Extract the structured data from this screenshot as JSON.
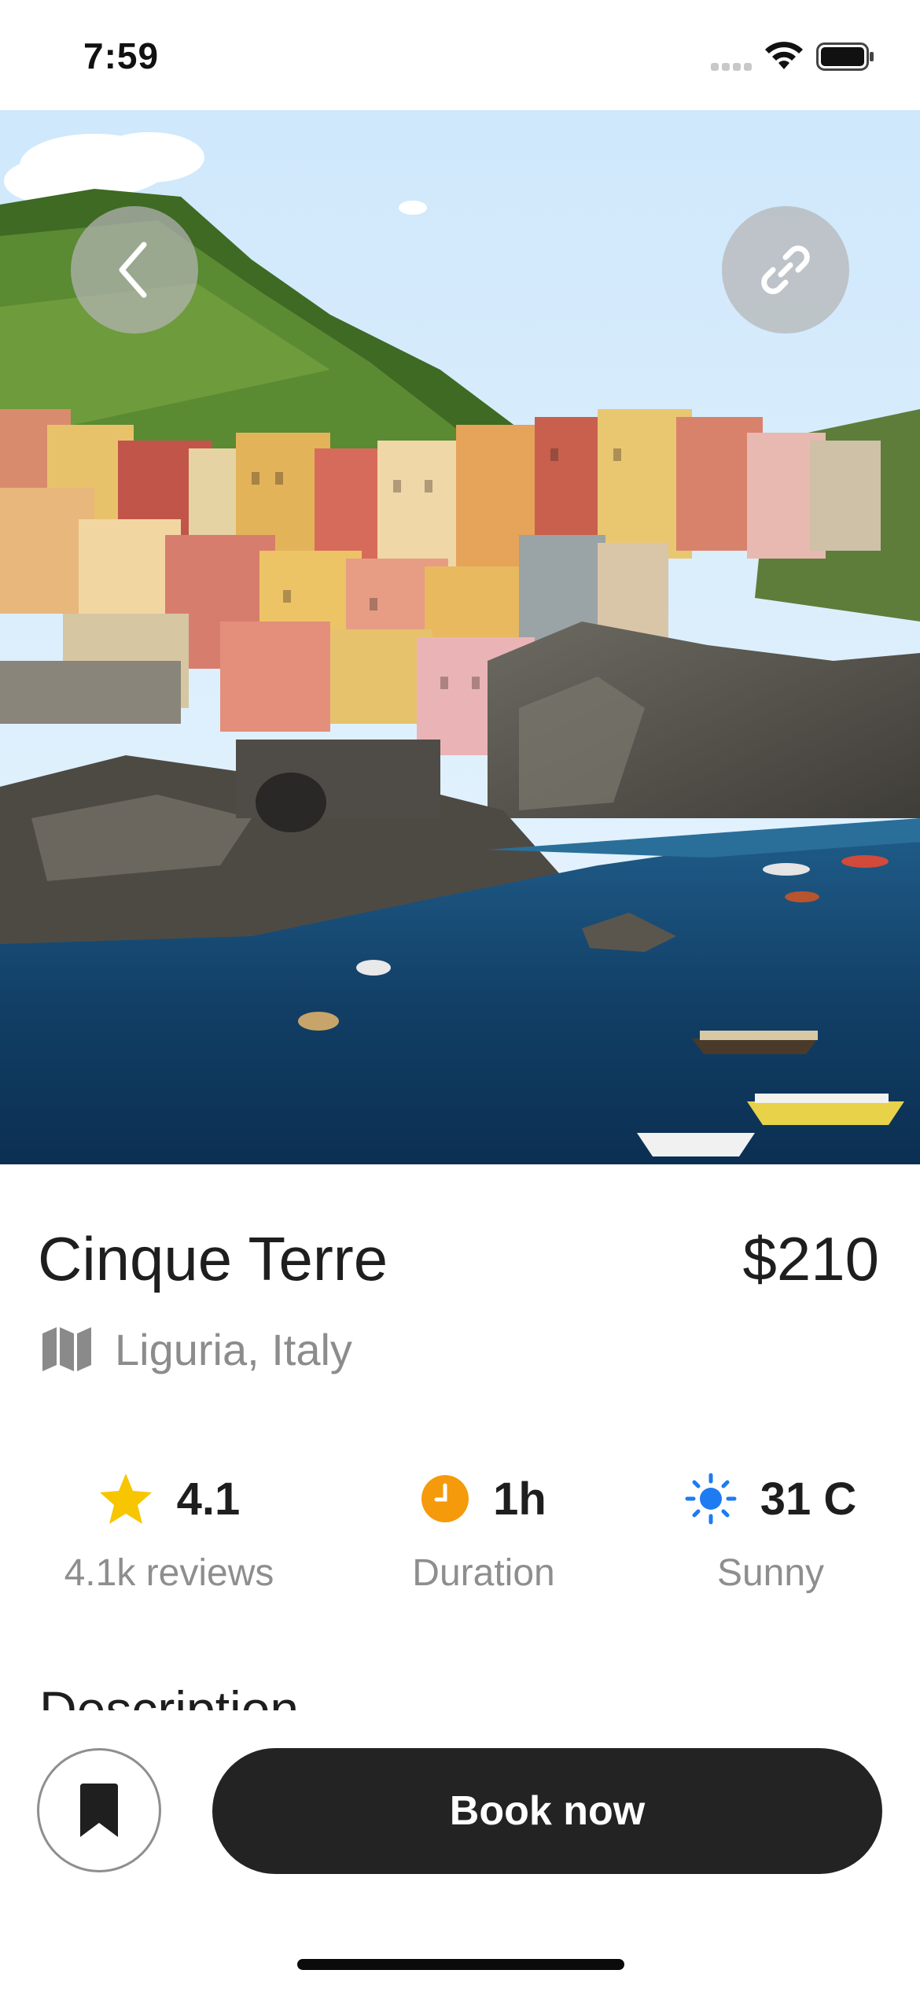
{
  "status_bar": {
    "time": "7:59"
  },
  "hero": {
    "back_icon": "chevron-left-icon",
    "share_icon": "link-icon"
  },
  "place": {
    "title": "Cinque Terre",
    "price": "$210",
    "location_icon": "map-icon",
    "location": "Liguria, Italy"
  },
  "stats": [
    {
      "icon": "star-icon",
      "value": "4.1",
      "label": "4.1k reviews",
      "color": "#F7C600"
    },
    {
      "icon": "clock-icon",
      "value": "1h",
      "label": "Duration",
      "color": "#F59A0B"
    },
    {
      "icon": "sun-icon",
      "value": "31 C",
      "label": "Sunny",
      "color": "#1E7BF2"
    }
  ],
  "description_heading": "Description",
  "bottom_bar": {
    "bookmark_icon": "bookmark-icon",
    "book_label": "Book now"
  }
}
